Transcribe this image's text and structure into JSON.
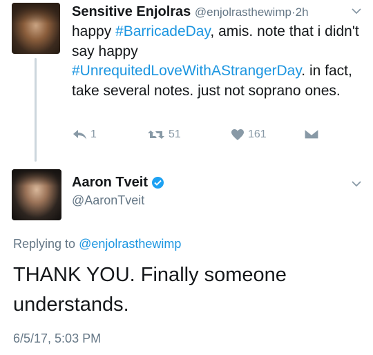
{
  "tweet1": {
    "display_name": "Sensitive Enjolras",
    "handle": "@enjolrasthewimp",
    "separator": "·",
    "time": "2h",
    "text_1": "happy ",
    "hashtag_1": "#BarricadeDay",
    "text_2": ", amis. note that i didn't say happy ",
    "hashtag_2": "#UnrequitedLoveWithAStrangerDay",
    "text_3": ". in fact, take several notes. just not soprano ones.",
    "reply_count": "1",
    "retweet_count": "51",
    "like_count": "161",
    "icons": [
      "reply-icon",
      "retweet-icon",
      "heart-icon",
      "message-icon",
      "chevron-down-icon"
    ]
  },
  "tweet2": {
    "display_name": "Aaron Tveit",
    "handle": "@AaronTveit",
    "replying_prefix": "Replying to ",
    "replying_handle": "@enjolrasthewimp",
    "text": "THANK YOU. Finally someone understands.",
    "date": "6/5/17, 5:03 PM",
    "icons": [
      "verified-icon",
      "chevron-down-icon"
    ]
  },
  "colors": {
    "link": "#1b95e0",
    "muted": "#657786",
    "icon_gray": "#8899a6",
    "verified": "#1da1f2",
    "thread_line": "#ccd6dd"
  }
}
